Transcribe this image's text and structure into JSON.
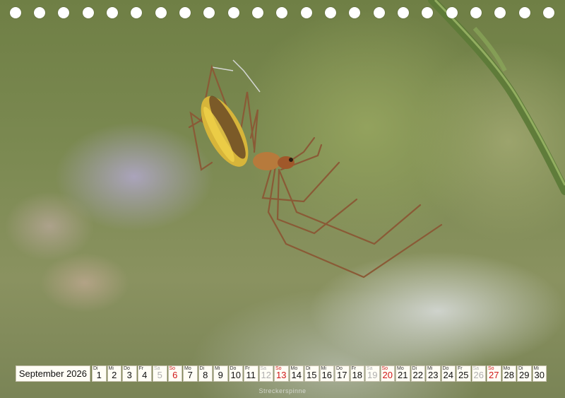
{
  "photo": {
    "subject": "spider"
  },
  "calendar": {
    "month_label": "September 2026",
    "days": [
      {
        "dow": "Di",
        "num": "1",
        "type": "wd"
      },
      {
        "dow": "Mi",
        "num": "2",
        "type": "wd"
      },
      {
        "dow": "Do",
        "num": "3",
        "type": "wd"
      },
      {
        "dow": "Fr",
        "num": "4",
        "type": "wd"
      },
      {
        "dow": "Sa",
        "num": "5",
        "type": "sa"
      },
      {
        "dow": "So",
        "num": "6",
        "type": "su"
      },
      {
        "dow": "Mo",
        "num": "7",
        "type": "wd"
      },
      {
        "dow": "Di",
        "num": "8",
        "type": "wd"
      },
      {
        "dow": "Mi",
        "num": "9",
        "type": "wd"
      },
      {
        "dow": "Do",
        "num": "10",
        "type": "wd"
      },
      {
        "dow": "Fr",
        "num": "11",
        "type": "wd"
      },
      {
        "dow": "Sa",
        "num": "12",
        "type": "sa"
      },
      {
        "dow": "So",
        "num": "13",
        "type": "su"
      },
      {
        "dow": "Mo",
        "num": "14",
        "type": "wd"
      },
      {
        "dow": "Di",
        "num": "15",
        "type": "wd"
      },
      {
        "dow": "Mi",
        "num": "16",
        "type": "wd"
      },
      {
        "dow": "Do",
        "num": "17",
        "type": "wd"
      },
      {
        "dow": "Fr",
        "num": "18",
        "type": "wd"
      },
      {
        "dow": "Sa",
        "num": "19",
        "type": "sa"
      },
      {
        "dow": "So",
        "num": "20",
        "type": "su"
      },
      {
        "dow": "Mo",
        "num": "21",
        "type": "wd"
      },
      {
        "dow": "Di",
        "num": "22",
        "type": "wd"
      },
      {
        "dow": "Mi",
        "num": "23",
        "type": "wd"
      },
      {
        "dow": "Do",
        "num": "24",
        "type": "wd"
      },
      {
        "dow": "Fr",
        "num": "25",
        "type": "wd"
      },
      {
        "dow": "Sa",
        "num": "26",
        "type": "sa"
      },
      {
        "dow": "So",
        "num": "27",
        "type": "su"
      },
      {
        "dow": "Mo",
        "num": "28",
        "type": "wd"
      },
      {
        "dow": "Di",
        "num": "29",
        "type": "wd"
      },
      {
        "dow": "Mi",
        "num": "30",
        "type": "wd"
      }
    ],
    "colors": {
      "sunday": "#d01818",
      "saturday": "#b0b0b0",
      "weekday": "#111111"
    }
  },
  "caption": "Streckerspinne"
}
